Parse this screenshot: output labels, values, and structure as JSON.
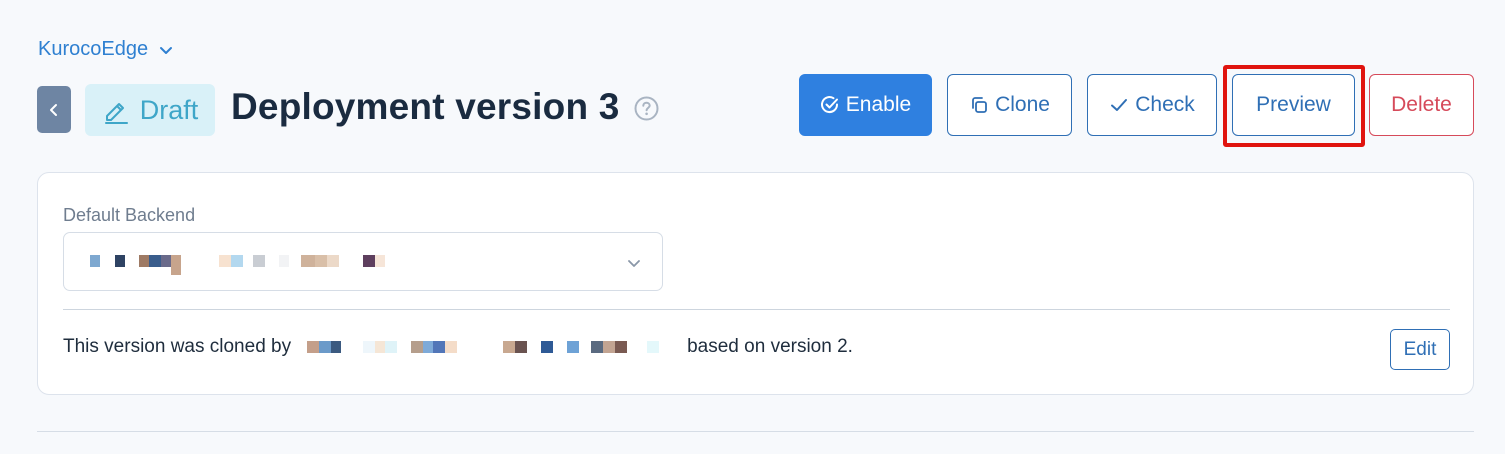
{
  "workspace": {
    "name": "KurocoEdge",
    "icon": "chevron-down-icon"
  },
  "header": {
    "back_icon": "chevron-left-icon",
    "status": "Draft",
    "status_icon": "pencil-icon",
    "title": "Deployment version 3",
    "help_icon": "question-circle-icon"
  },
  "actions": {
    "enable": "Enable",
    "clone": "Clone",
    "check": "Check",
    "preview": "Preview",
    "delete": "Delete"
  },
  "colors": {
    "primary": "#2f80e0",
    "outline": "#2f6fb5",
    "danger": "#d64a5a",
    "draft_badge_bg": "#d9f1f8",
    "draft_badge_text": "#3ea6c8",
    "highlight": "#e0140f"
  },
  "backend": {
    "label": "Default Backend",
    "value_redacted": true
  },
  "clone_info": {
    "prefix": "This version was cloned by",
    "suffix": "based on version 2.",
    "author_redacted": true,
    "edit_label": "Edit"
  }
}
